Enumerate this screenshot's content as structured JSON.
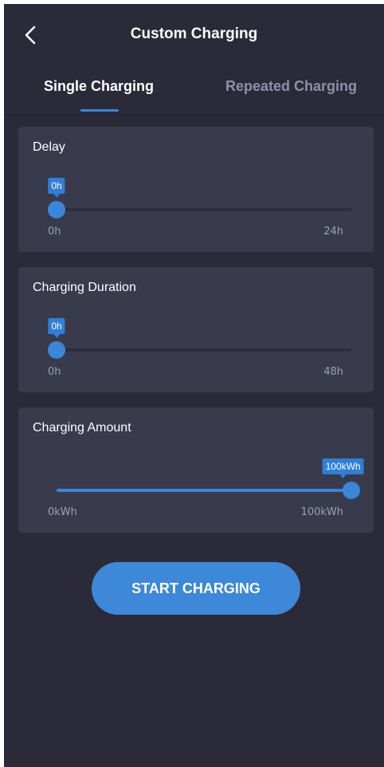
{
  "header": {
    "title": "Custom Charging",
    "back_icon": "chevron-left-icon"
  },
  "tabs": [
    {
      "label": "Single Charging",
      "active": true
    },
    {
      "label": "Repeated Charging",
      "active": false
    }
  ],
  "sliders": {
    "delay": {
      "label": "Delay",
      "value_label": "0h",
      "fraction": 0,
      "min_label": "0h",
      "max_label": "24h"
    },
    "duration": {
      "label": "Charging Duration",
      "value_label": "0h",
      "fraction": 0,
      "min_label": "0h",
      "max_label": "48h"
    },
    "amount": {
      "label": "Charging Amount",
      "value_label": "100kWh",
      "fraction": 1,
      "min_label": "0kWh",
      "max_label": "100kWh"
    }
  },
  "start_button": {
    "label": "START CHARGING"
  },
  "colors": {
    "background": "#2b2a38",
    "card": "#393a4c",
    "accent": "#3a86d8",
    "muted_text": "#9aa0b2"
  }
}
